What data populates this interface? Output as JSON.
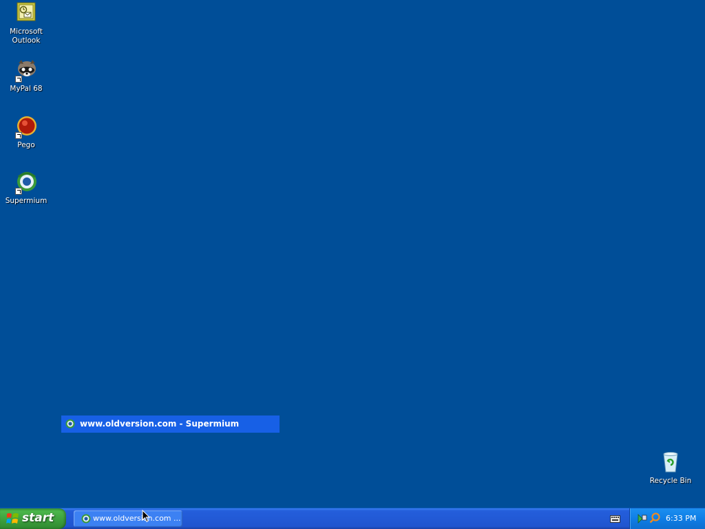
{
  "desktop": {
    "icons": [
      {
        "label_line1": "Microsoft",
        "label_line2": "Outlook",
        "icon": "outlook-icon"
      },
      {
        "label": "MyPal 68",
        "icon": "mypal-icon"
      },
      {
        "label": "Pego",
        "icon": "pego-icon"
      },
      {
        "label": "Supermium",
        "icon": "supermium-icon"
      }
    ],
    "recycle_bin": {
      "label": "Recycle Bin",
      "icon": "recycle-bin-icon"
    },
    "background_color": "#004e98"
  },
  "popup": {
    "title": "www.oldversion.com - Supermium",
    "icon": "supermium-icon"
  },
  "taskbar": {
    "start_label": "start",
    "task_button_label": "www.oldversion.com ...",
    "tray": {
      "icons": [
        "keyboard-icon",
        "network-icon",
        "search-icon"
      ],
      "clock": "6:33 PM"
    }
  }
}
